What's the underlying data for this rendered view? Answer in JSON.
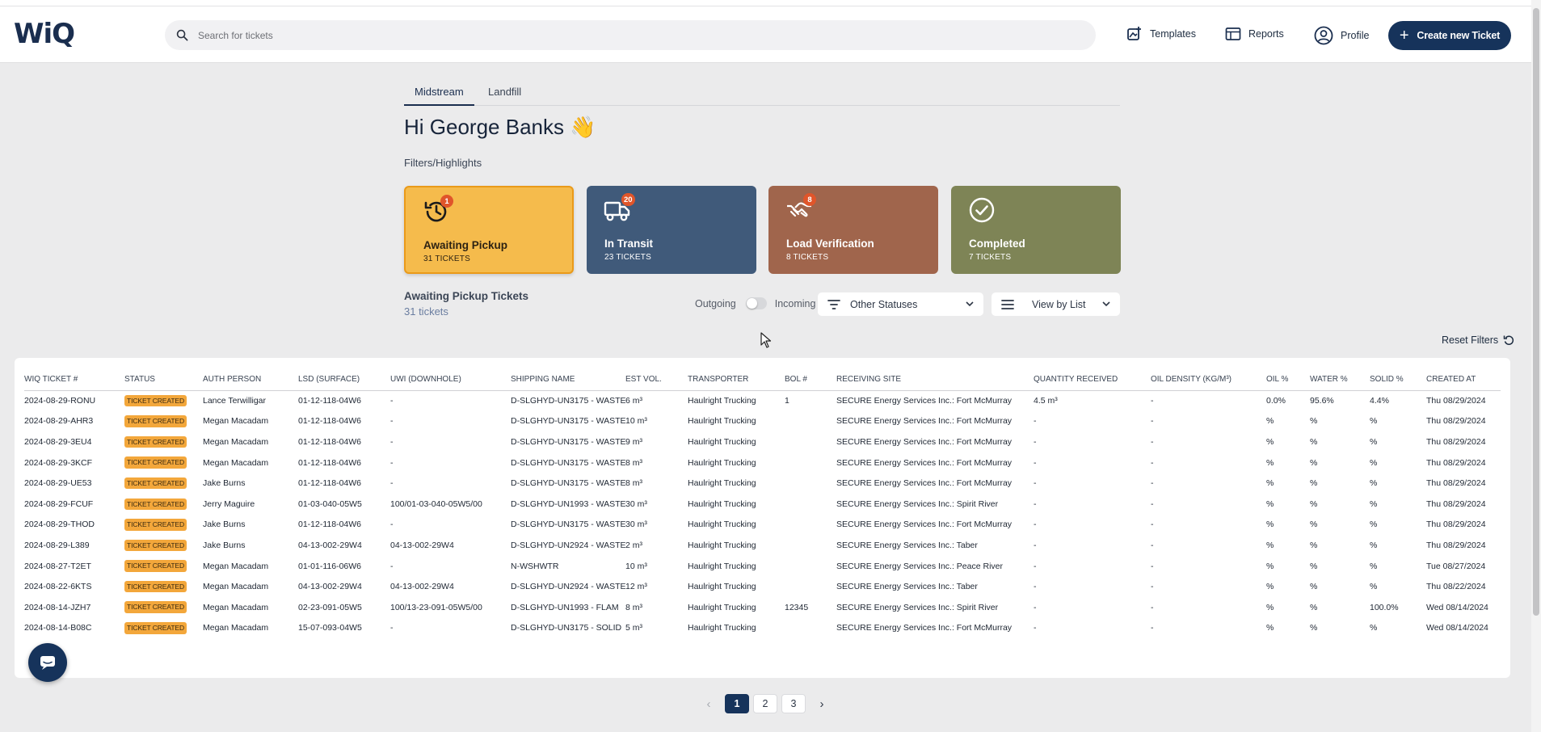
{
  "app": {
    "logo": "WiQ"
  },
  "search": {
    "placeholder": "Search for tickets"
  },
  "nav": {
    "templates": "Templates",
    "reports": "Reports",
    "profile": "Profile",
    "create": "Create new Ticket"
  },
  "tabs": [
    "Midstream",
    "Landfill"
  ],
  "greeting": "Hi George Banks 👋",
  "filters_title": "Filters/Highlights",
  "cards": [
    {
      "label": "Awaiting Pickup",
      "count": "31 TICKETS",
      "badge": "1",
      "icon": "history-icon"
    },
    {
      "label": "In Transit",
      "count": "23 TICKETS",
      "badge": "20",
      "icon": "truck-icon"
    },
    {
      "label": "Load Verification",
      "count": "8 TICKETS",
      "badge": "8",
      "icon": "handshake-icon"
    },
    {
      "label": "Completed",
      "count": "7 TICKETS",
      "badge": "",
      "icon": "check-circle-icon"
    }
  ],
  "list": {
    "title": "Awaiting Pickup Tickets",
    "subtitle": "31 tickets"
  },
  "toggle": {
    "left": "Outgoing",
    "right": "Incoming"
  },
  "dropdowns": {
    "status": "Other Statuses",
    "view": "View by List"
  },
  "reset": "Reset Filters",
  "table": {
    "headers": [
      "WIQ TICKET #",
      "STATUS",
      "AUTH PERSON",
      "LSD (SURFACE)",
      "UWI (DOWNHOLE)",
      "SHIPPING NAME",
      "EST VOL.",
      "TRANSPORTER",
      "BOL #",
      "RECEIVING SITE",
      "QUANTITY RECEIVED",
      "OIL DENSITY (KG/M³)",
      "OIL %",
      "WATER %",
      "SOLID %",
      "CREATED AT"
    ],
    "rows": [
      [
        "2024-08-29-RONU",
        "TICKET CREATED",
        "Lance Terwilligar",
        "01-12-118-04W6",
        "-",
        "D-SLGHYD-UN3175 - WASTE",
        "6 m³",
        "Haulright Trucking",
        "1",
        "SECURE Energy Services Inc.: Fort McMurray",
        "4.5 m³",
        "-",
        "0.0%",
        "95.6%",
        "4.4%",
        "Thu 08/29/2024"
      ],
      [
        "2024-08-29-AHR3",
        "TICKET CREATED",
        "Megan Macadam",
        "01-12-118-04W6",
        "-",
        "D-SLGHYD-UN3175 - WASTE",
        "10 m³",
        "Haulright Trucking",
        "",
        "SECURE Energy Services Inc.: Fort McMurray",
        "-",
        "-",
        "%",
        "%",
        "%",
        "Thu 08/29/2024"
      ],
      [
        "2024-08-29-3EU4",
        "TICKET CREATED",
        "Megan Macadam",
        "01-12-118-04W6",
        "-",
        "D-SLGHYD-UN3175 - WASTE",
        "9 m³",
        "Haulright Trucking",
        "",
        "SECURE Energy Services Inc.: Fort McMurray",
        "-",
        "-",
        "%",
        "%",
        "%",
        "Thu 08/29/2024"
      ],
      [
        "2024-08-29-3KCF",
        "TICKET CREATED",
        "Megan Macadam",
        "01-12-118-04W6",
        "-",
        "D-SLGHYD-UN3175 - WASTE",
        "8 m³",
        "Haulright Trucking",
        "",
        "SECURE Energy Services Inc.: Fort McMurray",
        "-",
        "-",
        "%",
        "%",
        "%",
        "Thu 08/29/2024"
      ],
      [
        "2024-08-29-UE53",
        "TICKET CREATED",
        "Jake Burns",
        "01-12-118-04W6",
        "-",
        "D-SLGHYD-UN3175 - WASTE",
        "8 m³",
        "Haulright Trucking",
        "",
        "SECURE Energy Services Inc.: Fort McMurray",
        "-",
        "-",
        "%",
        "%",
        "%",
        "Thu 08/29/2024"
      ],
      [
        "2024-08-29-FCUF",
        "TICKET CREATED",
        "Jerry Maguire",
        "01-03-040-05W5",
        "100/01-03-040-05W5/00",
        "D-SLGHYD-UN1993 - WASTE",
        "30 m³",
        "Haulright Trucking",
        "",
        "SECURE Energy Services Inc.: Spirit River",
        "-",
        "-",
        "%",
        "%",
        "%",
        "Thu 08/29/2024"
      ],
      [
        "2024-08-29-THOD",
        "TICKET CREATED",
        "Jake Burns",
        "01-12-118-04W6",
        "-",
        "D-SLGHYD-UN3175 - WASTE",
        "30 m³",
        "Haulright Trucking",
        "",
        "SECURE Energy Services Inc.: Fort McMurray",
        "-",
        "-",
        "%",
        "%",
        "%",
        "Thu 08/29/2024"
      ],
      [
        "2024-08-29-L389",
        "TICKET CREATED",
        "Jake Burns",
        "04-13-002-29W4",
        "04-13-002-29W4",
        "D-SLGHYD-UN2924 - WASTE",
        "2 m³",
        "Haulright Trucking",
        "",
        "SECURE Energy Services Inc.: Taber",
        "-",
        "-",
        "%",
        "%",
        "%",
        "Thu 08/29/2024"
      ],
      [
        "2024-08-27-T2ET",
        "TICKET CREATED",
        "Megan Macadam",
        "01-01-116-06W6",
        "-",
        "N-WSHWTR",
        "10 m³",
        "Haulright Trucking",
        "",
        "SECURE Energy Services Inc.: Peace River",
        "-",
        "-",
        "%",
        "%",
        "%",
        "Tue 08/27/2024"
      ],
      [
        "2024-08-22-6KTS",
        "TICKET CREATED",
        "Megan Macadam",
        "04-13-002-29W4",
        "04-13-002-29W4",
        "D-SLGHYD-UN2924 - WASTE",
        "12 m³",
        "Haulright Trucking",
        "",
        "SECURE Energy Services Inc.: Taber",
        "-",
        "-",
        "%",
        "%",
        "%",
        "Thu 08/22/2024"
      ],
      [
        "2024-08-14-JZH7",
        "TICKET CREATED",
        "Megan Macadam",
        "02-23-091-05W5",
        "100/13-23-091-05W5/00",
        "D-SLGHYD-UN1993 - FLAM",
        "8 m³",
        "Haulright Trucking",
        "12345",
        "SECURE Energy Services Inc.: Spirit River",
        "-",
        "-",
        "%",
        "%",
        "100.0%",
        "Wed 08/14/2024"
      ],
      [
        "2024-08-14-B08C",
        "TICKET CREATED",
        "Megan Macadam",
        "15-07-093-04W5",
        "-",
        "D-SLGHYD-UN3175 - SOLID",
        "5 m³",
        "Haulright Trucking",
        "",
        "SECURE Energy Services Inc.: Fort McMurray",
        "-",
        "-",
        "%",
        "%",
        "%",
        "Wed 08/14/2024"
      ]
    ]
  },
  "pagination": {
    "pages": [
      "1",
      "2",
      "3"
    ],
    "current": "1",
    "prev": "‹",
    "next": "›"
  },
  "colors": {
    "navy": "#16335b",
    "awaiting": "#f5bb4c",
    "transit": "#405a7a",
    "load": "#a0654c",
    "completed": "#7e8456",
    "badge": "#e0552a",
    "status_pill": "#f3a73b"
  }
}
